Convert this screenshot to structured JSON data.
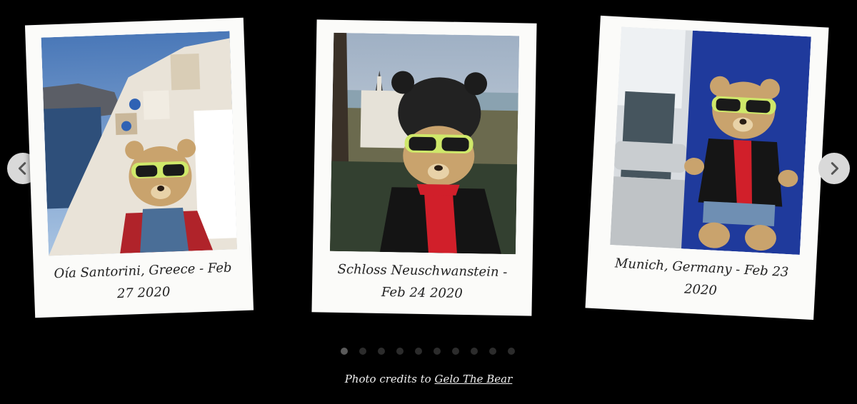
{
  "carousel": {
    "slides": [
      {
        "caption_line1": "Oía Santorini, Greece - Feb",
        "caption_line2": "27 2020",
        "photo_description_icon": "teddy-bear-santorini-photo"
      },
      {
        "caption_line1": "Schloss Neuschwanstein -",
        "caption_line2": "Feb 24 2020",
        "photo_description_icon": "teddy-bear-castle-photo"
      },
      {
        "caption_line1": "Munich, Germany - Feb 23",
        "caption_line2": "2020",
        "photo_description_icon": "teddy-bear-train-photo"
      }
    ],
    "prev_icon": "chevron-left-icon",
    "next_icon": "chevron-right-icon",
    "dot_count": 10,
    "active_dot": 1
  },
  "footer": {
    "credits_prefix": "Photo credits to",
    "credits_link": "Gelo The Bear"
  },
  "colors": {
    "background": "#000000",
    "polaroid": "#fbfbf9",
    "arrow_bg": "#d9d9d9"
  }
}
